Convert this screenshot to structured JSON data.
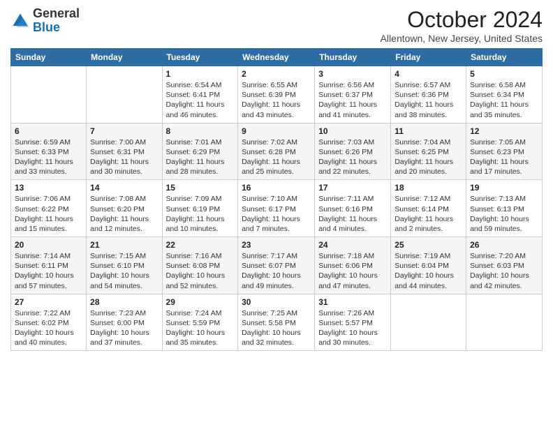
{
  "logo": {
    "general": "General",
    "blue": "Blue"
  },
  "header": {
    "month": "October 2024",
    "location": "Allentown, New Jersey, United States"
  },
  "weekdays": [
    "Sunday",
    "Monday",
    "Tuesday",
    "Wednesday",
    "Thursday",
    "Friday",
    "Saturday"
  ],
  "weeks": [
    [
      {
        "day": "",
        "sunrise": "",
        "sunset": "",
        "daylight": ""
      },
      {
        "day": "",
        "sunrise": "",
        "sunset": "",
        "daylight": ""
      },
      {
        "day": "1",
        "sunrise": "Sunrise: 6:54 AM",
        "sunset": "Sunset: 6:41 PM",
        "daylight": "Daylight: 11 hours and 46 minutes."
      },
      {
        "day": "2",
        "sunrise": "Sunrise: 6:55 AM",
        "sunset": "Sunset: 6:39 PM",
        "daylight": "Daylight: 11 hours and 43 minutes."
      },
      {
        "day": "3",
        "sunrise": "Sunrise: 6:56 AM",
        "sunset": "Sunset: 6:37 PM",
        "daylight": "Daylight: 11 hours and 41 minutes."
      },
      {
        "day": "4",
        "sunrise": "Sunrise: 6:57 AM",
        "sunset": "Sunset: 6:36 PM",
        "daylight": "Daylight: 11 hours and 38 minutes."
      },
      {
        "day": "5",
        "sunrise": "Sunrise: 6:58 AM",
        "sunset": "Sunset: 6:34 PM",
        "daylight": "Daylight: 11 hours and 35 minutes."
      }
    ],
    [
      {
        "day": "6",
        "sunrise": "Sunrise: 6:59 AM",
        "sunset": "Sunset: 6:33 PM",
        "daylight": "Daylight: 11 hours and 33 minutes."
      },
      {
        "day": "7",
        "sunrise": "Sunrise: 7:00 AM",
        "sunset": "Sunset: 6:31 PM",
        "daylight": "Daylight: 11 hours and 30 minutes."
      },
      {
        "day": "8",
        "sunrise": "Sunrise: 7:01 AM",
        "sunset": "Sunset: 6:29 PM",
        "daylight": "Daylight: 11 hours and 28 minutes."
      },
      {
        "day": "9",
        "sunrise": "Sunrise: 7:02 AM",
        "sunset": "Sunset: 6:28 PM",
        "daylight": "Daylight: 11 hours and 25 minutes."
      },
      {
        "day": "10",
        "sunrise": "Sunrise: 7:03 AM",
        "sunset": "Sunset: 6:26 PM",
        "daylight": "Daylight: 11 hours and 22 minutes."
      },
      {
        "day": "11",
        "sunrise": "Sunrise: 7:04 AM",
        "sunset": "Sunset: 6:25 PM",
        "daylight": "Daylight: 11 hours and 20 minutes."
      },
      {
        "day": "12",
        "sunrise": "Sunrise: 7:05 AM",
        "sunset": "Sunset: 6:23 PM",
        "daylight": "Daylight: 11 hours and 17 minutes."
      }
    ],
    [
      {
        "day": "13",
        "sunrise": "Sunrise: 7:06 AM",
        "sunset": "Sunset: 6:22 PM",
        "daylight": "Daylight: 11 hours and 15 minutes."
      },
      {
        "day": "14",
        "sunrise": "Sunrise: 7:08 AM",
        "sunset": "Sunset: 6:20 PM",
        "daylight": "Daylight: 11 hours and 12 minutes."
      },
      {
        "day": "15",
        "sunrise": "Sunrise: 7:09 AM",
        "sunset": "Sunset: 6:19 PM",
        "daylight": "Daylight: 11 hours and 10 minutes."
      },
      {
        "day": "16",
        "sunrise": "Sunrise: 7:10 AM",
        "sunset": "Sunset: 6:17 PM",
        "daylight": "Daylight: 11 hours and 7 minutes."
      },
      {
        "day": "17",
        "sunrise": "Sunrise: 7:11 AM",
        "sunset": "Sunset: 6:16 PM",
        "daylight": "Daylight: 11 hours and 4 minutes."
      },
      {
        "day": "18",
        "sunrise": "Sunrise: 7:12 AM",
        "sunset": "Sunset: 6:14 PM",
        "daylight": "Daylight: 11 hours and 2 minutes."
      },
      {
        "day": "19",
        "sunrise": "Sunrise: 7:13 AM",
        "sunset": "Sunset: 6:13 PM",
        "daylight": "Daylight: 10 hours and 59 minutes."
      }
    ],
    [
      {
        "day": "20",
        "sunrise": "Sunrise: 7:14 AM",
        "sunset": "Sunset: 6:11 PM",
        "daylight": "Daylight: 10 hours and 57 minutes."
      },
      {
        "day": "21",
        "sunrise": "Sunrise: 7:15 AM",
        "sunset": "Sunset: 6:10 PM",
        "daylight": "Daylight: 10 hours and 54 minutes."
      },
      {
        "day": "22",
        "sunrise": "Sunrise: 7:16 AM",
        "sunset": "Sunset: 6:08 PM",
        "daylight": "Daylight: 10 hours and 52 minutes."
      },
      {
        "day": "23",
        "sunrise": "Sunrise: 7:17 AM",
        "sunset": "Sunset: 6:07 PM",
        "daylight": "Daylight: 10 hours and 49 minutes."
      },
      {
        "day": "24",
        "sunrise": "Sunrise: 7:18 AM",
        "sunset": "Sunset: 6:06 PM",
        "daylight": "Daylight: 10 hours and 47 minutes."
      },
      {
        "day": "25",
        "sunrise": "Sunrise: 7:19 AM",
        "sunset": "Sunset: 6:04 PM",
        "daylight": "Daylight: 10 hours and 44 minutes."
      },
      {
        "day": "26",
        "sunrise": "Sunrise: 7:20 AM",
        "sunset": "Sunset: 6:03 PM",
        "daylight": "Daylight: 10 hours and 42 minutes."
      }
    ],
    [
      {
        "day": "27",
        "sunrise": "Sunrise: 7:22 AM",
        "sunset": "Sunset: 6:02 PM",
        "daylight": "Daylight: 10 hours and 40 minutes."
      },
      {
        "day": "28",
        "sunrise": "Sunrise: 7:23 AM",
        "sunset": "Sunset: 6:00 PM",
        "daylight": "Daylight: 10 hours and 37 minutes."
      },
      {
        "day": "29",
        "sunrise": "Sunrise: 7:24 AM",
        "sunset": "Sunset: 5:59 PM",
        "daylight": "Daylight: 10 hours and 35 minutes."
      },
      {
        "day": "30",
        "sunrise": "Sunrise: 7:25 AM",
        "sunset": "Sunset: 5:58 PM",
        "daylight": "Daylight: 10 hours and 32 minutes."
      },
      {
        "day": "31",
        "sunrise": "Sunrise: 7:26 AM",
        "sunset": "Sunset: 5:57 PM",
        "daylight": "Daylight: 10 hours and 30 minutes."
      },
      {
        "day": "",
        "sunrise": "",
        "sunset": "",
        "daylight": ""
      },
      {
        "day": "",
        "sunrise": "",
        "sunset": "",
        "daylight": ""
      }
    ]
  ]
}
